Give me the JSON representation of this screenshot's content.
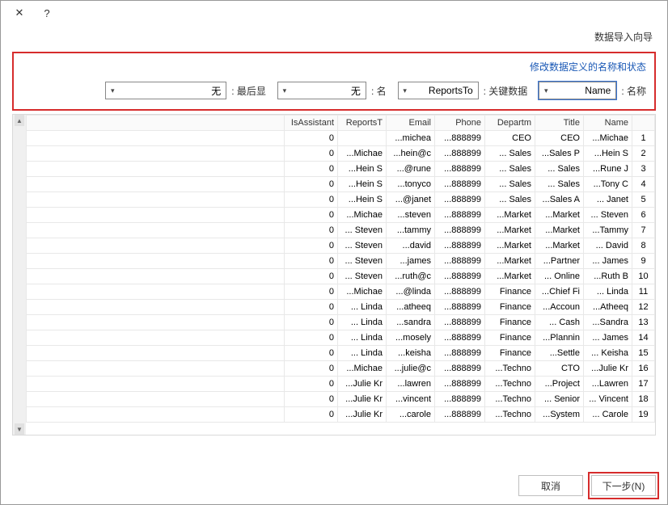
{
  "titlebar": {
    "close_glyph": "✕",
    "help_glyph": "?"
  },
  "wizard_title": "数据导入向导",
  "config": {
    "caption": "修改数据定义的名称和状态",
    "name_label": "名称 :",
    "name_value": "Name",
    "keycol_label": "关键数据 :",
    "keycol_value": "ReportsTo",
    "name2_label": "名 :",
    "name2_value": "无",
    "last_label": "最后显 :",
    "last_value": "无"
  },
  "grid": {
    "headers": {
      "idx": "",
      "name": "Name",
      "title": "Title",
      "dept": "Departm",
      "phone": "Phone",
      "email": "Email",
      "rep": "ReportsT",
      "asst": "IsAssistant"
    },
    "rows": [
      {
        "i": "1",
        "name": "Michae...",
        "title": "CEO",
        "dept": "CEO",
        "phone": "888899...",
        "email": "michea...",
        "rep": "",
        "asst": "0"
      },
      {
        "i": "2",
        "name": "Hein S...",
        "title": "Sales P...",
        "dept": "Sales ...",
        "phone": "888899...",
        "email": "hein@c...",
        "rep": "Michae...",
        "asst": "0"
      },
      {
        "i": "3",
        "name": "Rune J...",
        "title": "Sales ...",
        "dept": "Sales ...",
        "phone": "888899...",
        "email": "rune@...",
        "rep": "Hein S...",
        "asst": "0"
      },
      {
        "i": "4",
        "name": "Tony C...",
        "title": "Sales ...",
        "dept": "Sales ...",
        "phone": "888899...",
        "email": "tonyco...",
        "rep": "Hein S...",
        "asst": "0"
      },
      {
        "i": "5",
        "name": "Janet ...",
        "title": "Sales A...",
        "dept": "Sales ...",
        "phone": "888899...",
        "email": "janet@...",
        "rep": "Hein S...",
        "asst": "0"
      },
      {
        "i": "6",
        "name": "Steven ...",
        "title": "Market...",
        "dept": "Market...",
        "phone": "888899...",
        "email": "steven...",
        "rep": "Michae...",
        "asst": "0"
      },
      {
        "i": "7",
        "name": "Tammy...",
        "title": "Market...",
        "dept": "Market...",
        "phone": "888899...",
        "email": "tammy...",
        "rep": "Steven ...",
        "asst": "0"
      },
      {
        "i": "8",
        "name": "David ...",
        "title": "Market...",
        "dept": "Market...",
        "phone": "888899...",
        "email": "david...",
        "rep": "Steven ...",
        "asst": "0"
      },
      {
        "i": "9",
        "name": "James ...",
        "title": "Partner...",
        "dept": "Market...",
        "phone": "888899...",
        "email": "james...",
        "rep": "Steven ...",
        "asst": "0"
      },
      {
        "i": "10",
        "name": "Ruth B...",
        "title": "Online ...",
        "dept": "Market...",
        "phone": "888899...",
        "email": "ruth@c...",
        "rep": "Steven ...",
        "asst": "0"
      },
      {
        "i": "11",
        "name": "Linda ...",
        "title": "Chief Fi...",
        "dept": "Finance",
        "phone": "888899...",
        "email": "linda@...",
        "rep": "Michae...",
        "asst": "0"
      },
      {
        "i": "12",
        "name": "Atheeq...",
        "title": "Accoun...",
        "dept": "Finance",
        "phone": "888899...",
        "email": "atheeq...",
        "rep": "Linda ...",
        "asst": "0"
      },
      {
        "i": "13",
        "name": "Sandra...",
        "title": "Cash ...",
        "dept": "Finance",
        "phone": "888899...",
        "email": "sandra...",
        "rep": "Linda ...",
        "asst": "0"
      },
      {
        "i": "14",
        "name": "James ...",
        "title": "Plannin...",
        "dept": "Finance",
        "phone": "888899...",
        "email": "mosely...",
        "rep": "Linda ...",
        "asst": "0"
      },
      {
        "i": "15",
        "name": "Keisha ...",
        "title": "Settle...",
        "dept": "Finance",
        "phone": "888899...",
        "email": "keisha...",
        "rep": "Linda ...",
        "asst": "0"
      },
      {
        "i": "16",
        "name": "Julie Kr...",
        "title": "CTO",
        "dept": "Techno...",
        "phone": "888899...",
        "email": "julie@c...",
        "rep": "Michae...",
        "asst": "0"
      },
      {
        "i": "17",
        "name": "Lawren...",
        "title": "Project...",
        "dept": "Techno...",
        "phone": "888899...",
        "email": "lawren...",
        "rep": "Julie Kr...",
        "asst": "0"
      },
      {
        "i": "18",
        "name": "Vincent ...",
        "title": "Senior ...",
        "dept": "Techno...",
        "phone": "888899...",
        "email": "vincent...",
        "rep": "Julie Kr...",
        "asst": "0"
      },
      {
        "i": "19",
        "name": "Carole ...",
        "title": "System...",
        "dept": "Techno...",
        "phone": "888899...",
        "email": "carole...",
        "rep": "Julie Kr...",
        "asst": "0"
      }
    ]
  },
  "footer": {
    "next": "下一步(N)",
    "cancel": "取消"
  }
}
